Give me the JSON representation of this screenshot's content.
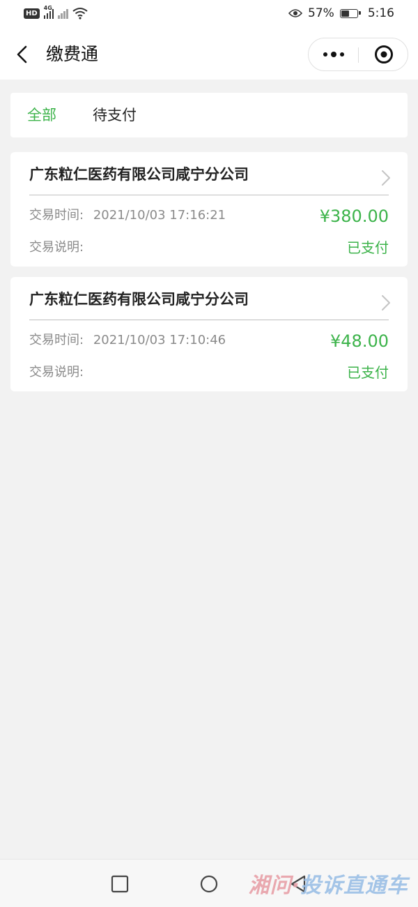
{
  "status_bar": {
    "hd_badge": "HD",
    "network_tag": "4G",
    "battery_percent": "57%",
    "battery_level": 0.57,
    "time": "5:16"
  },
  "nav": {
    "title": "缴费通",
    "back_icon": "chevron-left-icon",
    "more_icon": "more-dots-icon",
    "close_icon": "target-close-icon"
  },
  "tabs": [
    {
      "label": "全部",
      "active": true
    },
    {
      "label": "待支付",
      "active": false
    }
  ],
  "transactions": [
    {
      "merchant": "广东粒仁医药有限公司咸宁分公司",
      "time_label": "交易时间:",
      "time": "2021/10/03 17:16:21",
      "desc_label": "交易说明:",
      "amount": "¥380.00",
      "status": "已支付"
    },
    {
      "merchant": "广东粒仁医药有限公司咸宁分公司",
      "time_label": "交易时间:",
      "time": "2021/10/03 17:10:46",
      "desc_label": "交易说明:",
      "amount": "¥48.00",
      "status": "已支付"
    }
  ],
  "watermark": {
    "part1": "湘问·",
    "part2": "投诉直通车"
  },
  "colors": {
    "accent": "#3cb34a",
    "background": "#f2f2f2",
    "muted_text": "#8a8a8a"
  }
}
